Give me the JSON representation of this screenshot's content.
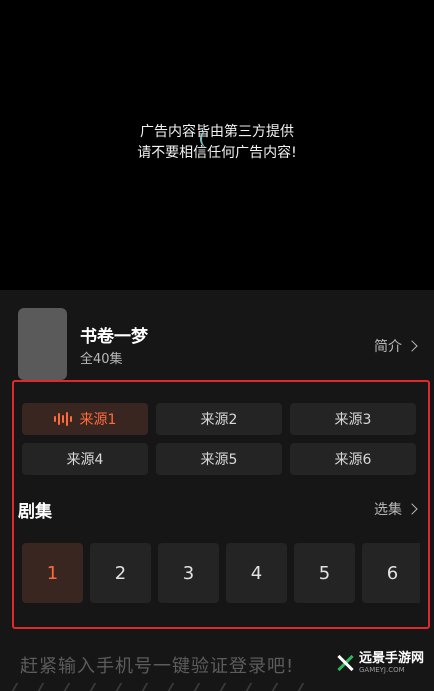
{
  "video": {
    "ad_notice_line1": "广告内容皆由第三方提供",
    "ad_notice_line2": "请不要相信任何广告内容!"
  },
  "show": {
    "title": "书卷一梦",
    "episode_count": "全40集",
    "intro_label": "简介"
  },
  "sources": [
    {
      "label": "来源1",
      "active": true
    },
    {
      "label": "来源2",
      "active": false
    },
    {
      "label": "来源3",
      "active": false
    },
    {
      "label": "来源4",
      "active": false
    },
    {
      "label": "来源5",
      "active": false
    },
    {
      "label": "来源6",
      "active": false
    }
  ],
  "episodes": {
    "title": "剧集",
    "select_label": "选集",
    "items": [
      "1",
      "2",
      "3",
      "4",
      "5",
      "6"
    ],
    "active_index": 0
  },
  "login_prompt": "赶紧输入手机号一键验证登录吧!",
  "watermark": {
    "name": "远景手游网",
    "domain": "GAMEYJ.COM"
  },
  "colors": {
    "accent": "#ff6a3d",
    "highlight_border": "#e02a2a",
    "watermark_green": "#2fb85a"
  }
}
